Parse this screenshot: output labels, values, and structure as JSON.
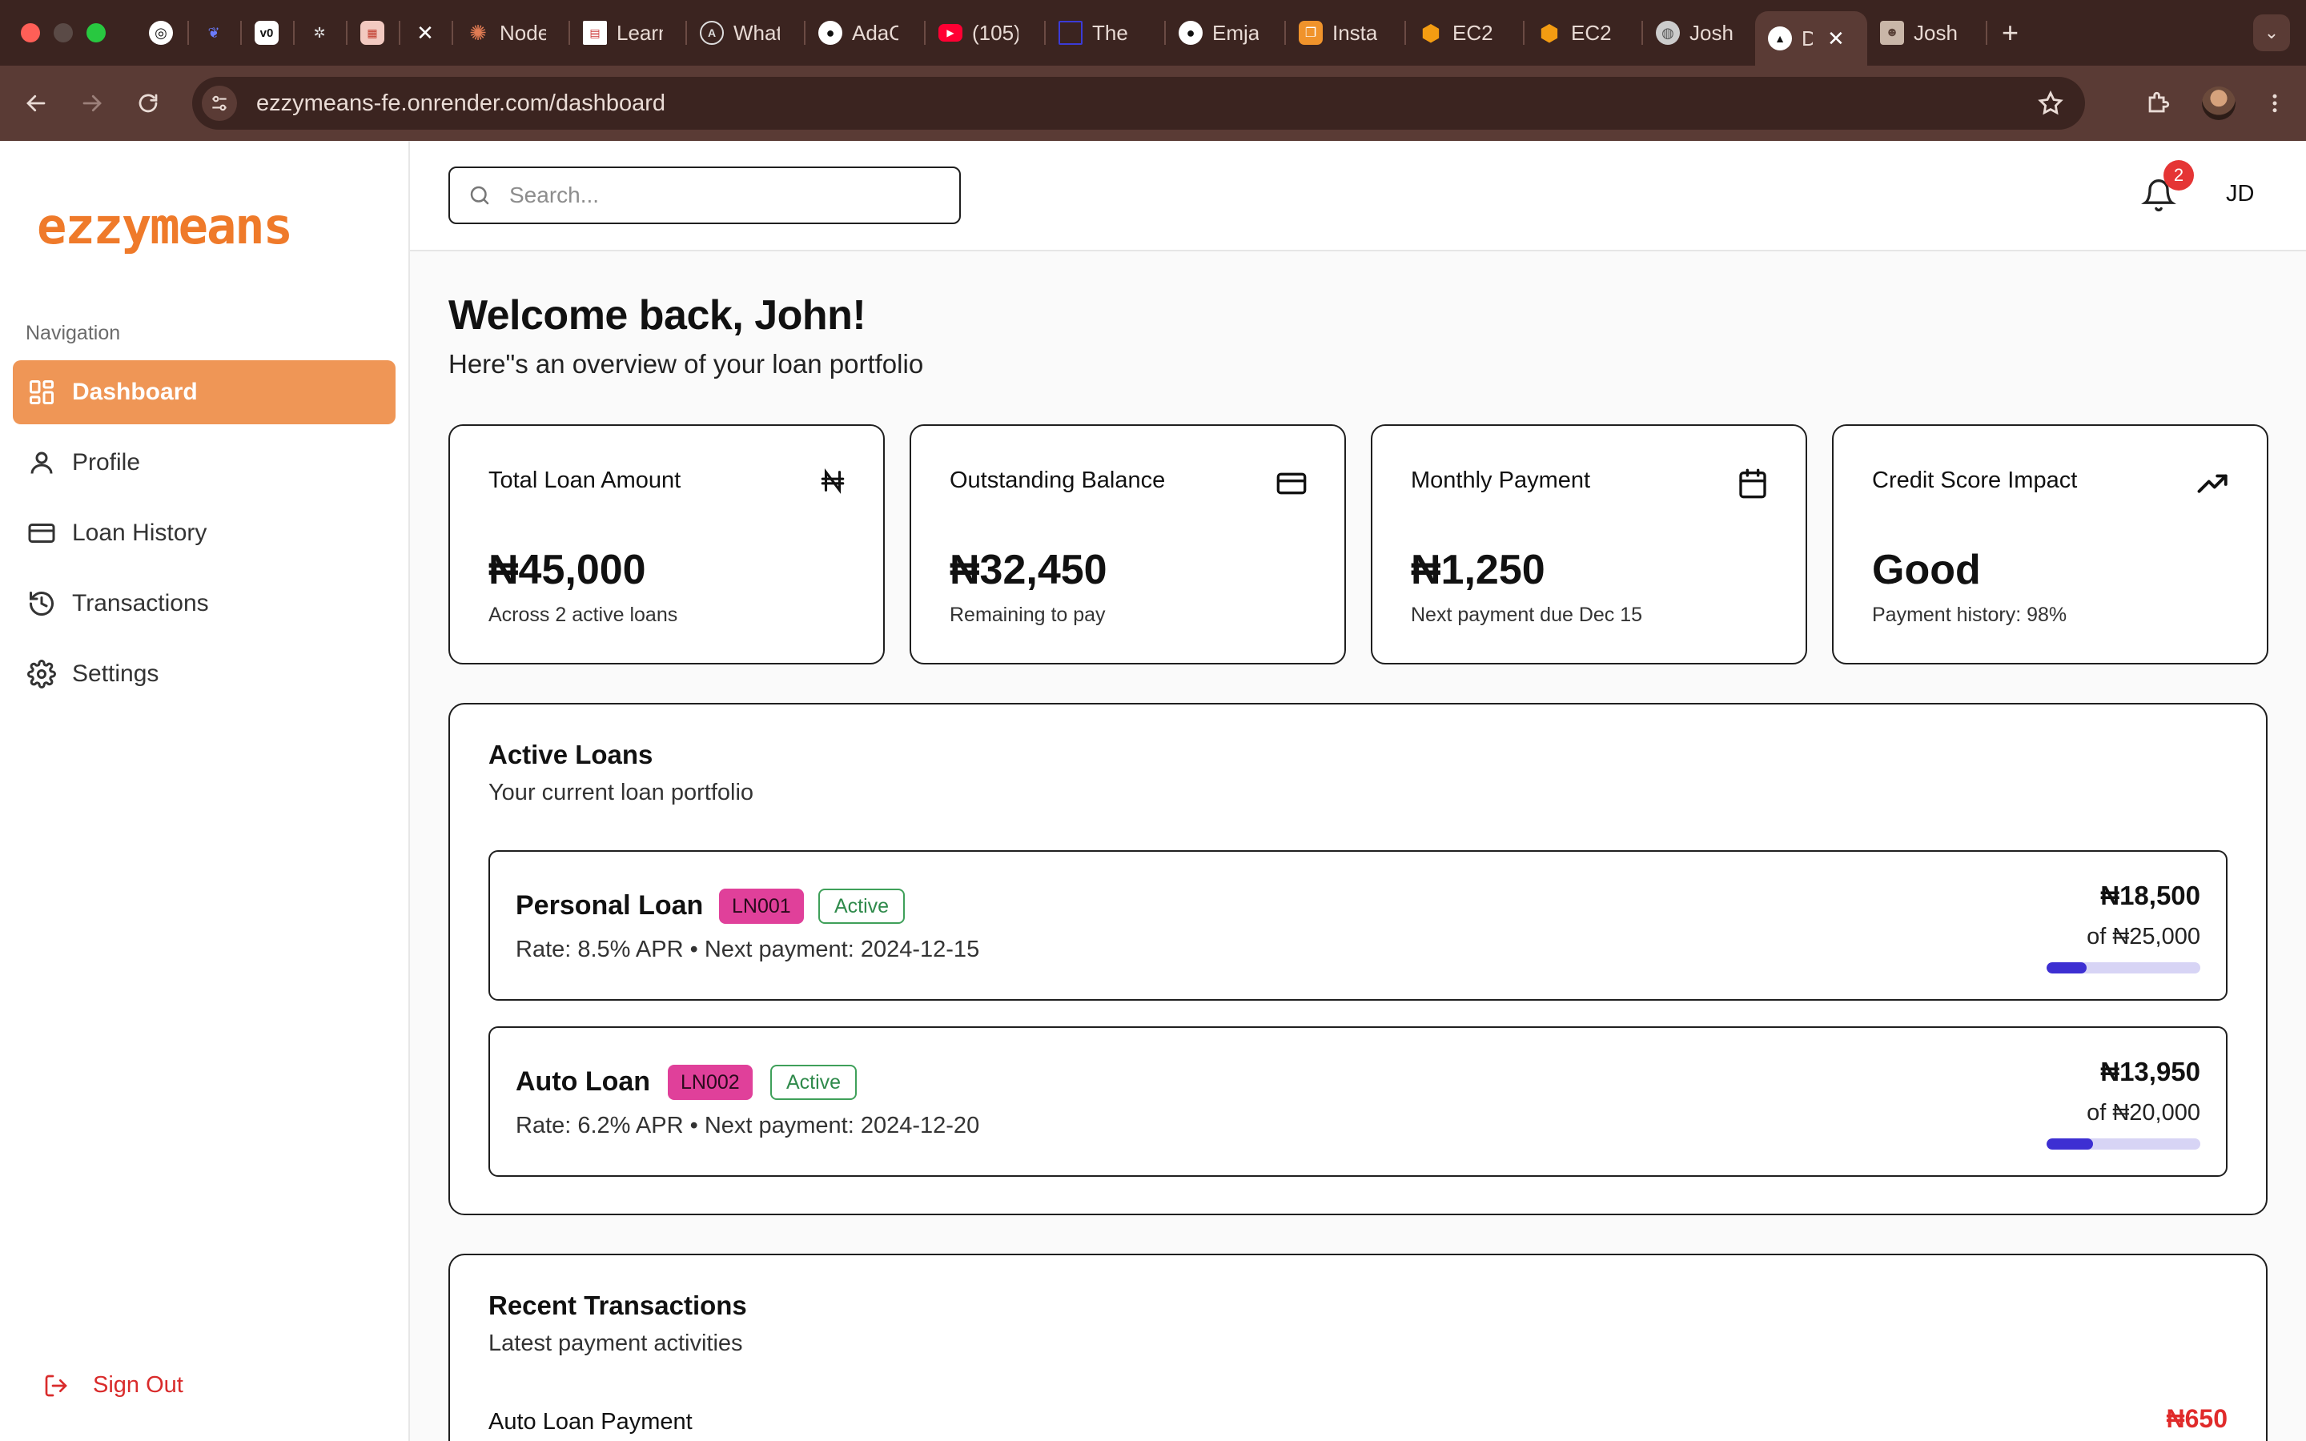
{
  "browser": {
    "tabs": [
      {
        "title": "",
        "icon": "openai-icon"
      },
      {
        "title": "",
        "icon": "deepseek-icon"
      },
      {
        "title": "",
        "icon": "v0-icon"
      },
      {
        "title": "",
        "icon": "bug-icon"
      },
      {
        "title": "",
        "icon": "gear-icon"
      },
      {
        "title": "",
        "icon": "x-icon"
      },
      {
        "title": "Node",
        "icon": "claude-icon"
      },
      {
        "title": "Learn",
        "icon": "doc-icon"
      },
      {
        "title": "What",
        "icon": "circle-a-icon"
      },
      {
        "title": "AdaO",
        "icon": "github-icon"
      },
      {
        "title": "(105)",
        "icon": "youtube-icon"
      },
      {
        "title": "The",
        "icon": "frame-icon"
      },
      {
        "title": "Emja",
        "icon": "github-icon"
      },
      {
        "title": "Insta",
        "icon": "copy-icon"
      },
      {
        "title": "EC2",
        "icon": "aws-icon"
      },
      {
        "title": "EC2",
        "icon": "aws-icon"
      },
      {
        "title": "Josh",
        "icon": "globe-icon"
      },
      {
        "title": "D",
        "icon": "vercel-icon",
        "active": true
      },
      {
        "title": "Josh",
        "icon": "photo-icon"
      }
    ],
    "url": "ezzymeans-fe.onrender.com/dashboard"
  },
  "sidebar": {
    "logo": "ezzymeans",
    "nav_heading": "Navigation",
    "items": [
      {
        "label": "Dashboard",
        "icon": "dashboard-icon",
        "active": true
      },
      {
        "label": "Profile",
        "icon": "user-icon"
      },
      {
        "label": "Loan History",
        "icon": "card-icon"
      },
      {
        "label": "Transactions",
        "icon": "history-icon"
      },
      {
        "label": "Settings",
        "icon": "settings-icon"
      }
    ],
    "sign_out": "Sign Out"
  },
  "header": {
    "search_placeholder": "Search...",
    "notification_count": "2",
    "user_initials": "JD"
  },
  "main": {
    "welcome": "Welcome back, John!",
    "subtitle": "Here\"s an overview of your loan portfolio",
    "stats": [
      {
        "label": "Total Loan Amount",
        "value": "₦45,000",
        "note": "Across 2 active loans",
        "icon": "naira-icon"
      },
      {
        "label": "Outstanding Balance",
        "value": "₦32,450",
        "note": "Remaining to pay",
        "icon": "credit-card-icon"
      },
      {
        "label": "Monthly Payment",
        "value": "₦1,250",
        "note": "Next payment due Dec 15",
        "icon": "calendar-icon"
      },
      {
        "label": "Credit Score Impact",
        "value": "Good",
        "note": "Payment history: 98%",
        "icon": "trending-up-icon"
      }
    ],
    "active_loans": {
      "title": "Active Loans",
      "subtitle": "Your current loan portfolio",
      "loans": [
        {
          "name": "Personal Loan",
          "id": "LN001",
          "status": "Active",
          "detail": "Rate: 8.5% APR • Next payment: 2024-12-15",
          "remaining": "₦18,500",
          "total": "of ₦25,000",
          "progress": 0.26
        },
        {
          "name": "Auto Loan",
          "id": "LN002",
          "status": "Active",
          "detail": "Rate: 6.2% APR • Next payment: 2024-12-20",
          "remaining": "₦13,950",
          "total": "of ₦20,000",
          "progress": 0.3
        }
      ]
    },
    "recent_transactions": {
      "title": "Recent Transactions",
      "subtitle": "Latest payment activities",
      "items": [
        {
          "label": "Auto Loan Payment",
          "amount": "₦650"
        }
      ]
    }
  },
  "colors": {
    "brand": "#ef7a2a",
    "nav_active": "#ef9656",
    "loan_id_badge": "#e0409a",
    "status_active": "#2f8a4b",
    "progress_fill": "#3d2fd2",
    "progress_track": "#d7d4f5",
    "danger": "#e02b2b"
  }
}
